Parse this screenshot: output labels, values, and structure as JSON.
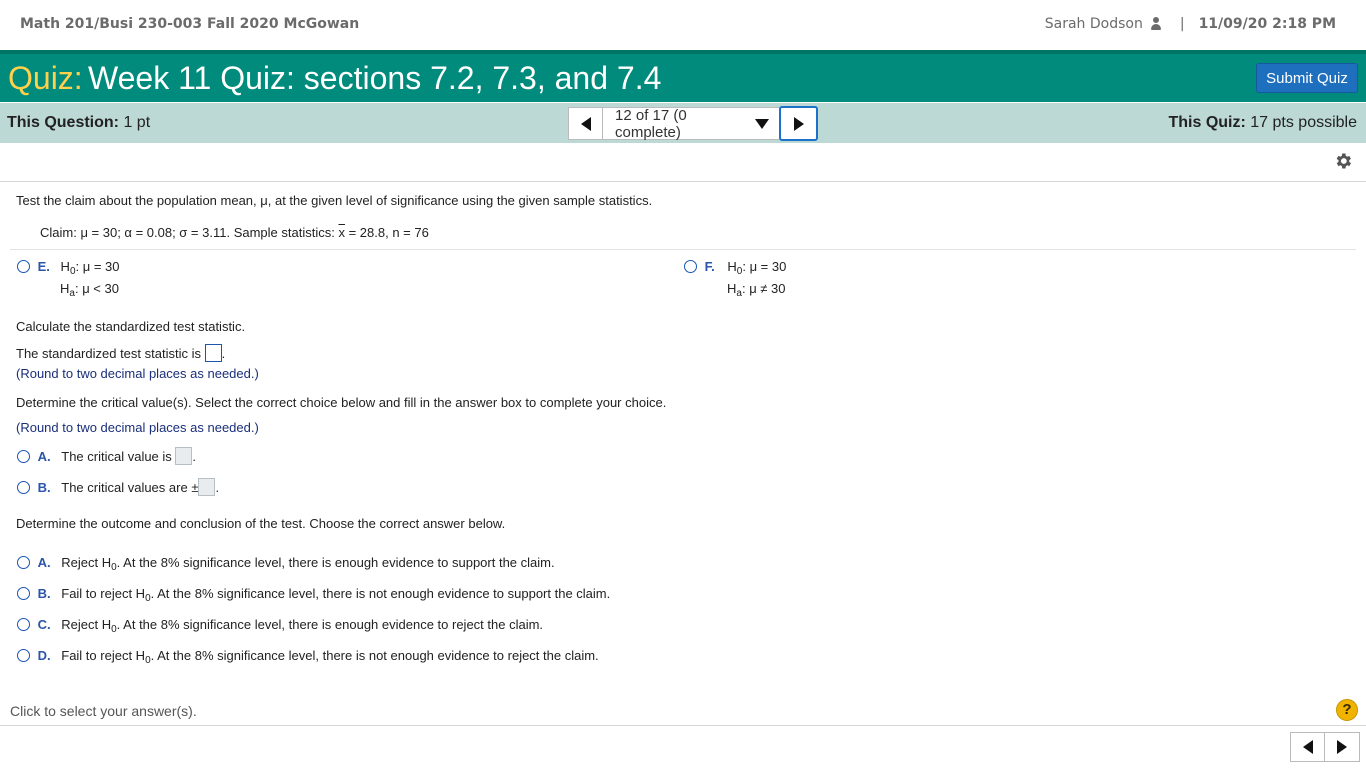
{
  "header": {
    "course": "Math 201/Busi 230-003 Fall 2020 McGowan",
    "user": "Sarah Dodson",
    "separator": "|",
    "datetime": "11/09/20 2:18 PM"
  },
  "quiz": {
    "label": "Quiz:",
    "title": "Week 11 Quiz: sections 7.2, 7.3, and 7.4",
    "submit_label": "Submit Quiz"
  },
  "infobar": {
    "this_question_label": "This Question:",
    "this_question_value": "1 pt",
    "progress": "12 of 17 (0 complete)",
    "this_quiz_label": "This Quiz:",
    "this_quiz_value": "17 pts possible"
  },
  "question": {
    "prompt": "Test the claim about the population mean, μ, at the given level of significance using the given sample statistics.",
    "claim_prefix": "Claim: μ = 30; α = 0.08; σ = 3.11. Sample statistics:",
    "claim_xbar": "x",
    "claim_suffix": "= 28.8, n = 76",
    "hypotheses": [
      {
        "letter": "E.",
        "h0": "μ = 30",
        "ha": "μ < 30"
      },
      {
        "letter": "F.",
        "h0": "μ = 30",
        "ha": "μ ≠ 30"
      }
    ],
    "calc_prompt": "Calculate the standardized test statistic.",
    "stat_label": "The standardized test statistic is",
    "round_hint": "(Round to two decimal places as needed.)",
    "critical_prompt": "Determine the critical value(s). Select the correct choice below and fill in the answer box to complete your choice.",
    "critical_choices": [
      {
        "letter": "A.",
        "text": "The critical value is",
        "prefix": ""
      },
      {
        "letter": "B.",
        "text": "The critical values are",
        "prefix": "±"
      }
    ],
    "outcome_prompt": "Determine the outcome and conclusion of the test. Choose the correct answer below.",
    "outcomes": [
      {
        "letter": "A.",
        "action": "Reject H",
        "rest": ". At the 8% significance level, there is enough evidence to support the claim."
      },
      {
        "letter": "B.",
        "action": "Fail to reject H",
        "rest": ". At the 8% significance level, there is not enough evidence to support the claim."
      },
      {
        "letter": "C.",
        "action": "Reject H",
        "rest": ". At the 8% significance level, there is enough evidence to reject the claim."
      },
      {
        "letter": "D.",
        "action": "Fail to reject H",
        "rest": ". At the 8% significance level, there is not enough evidence to reject the claim."
      }
    ],
    "h_label": "H",
    "sub_0": "0",
    "sub_a": "a"
  },
  "footer": {
    "status": "Click to select your answer(s).",
    "help": "?"
  }
}
